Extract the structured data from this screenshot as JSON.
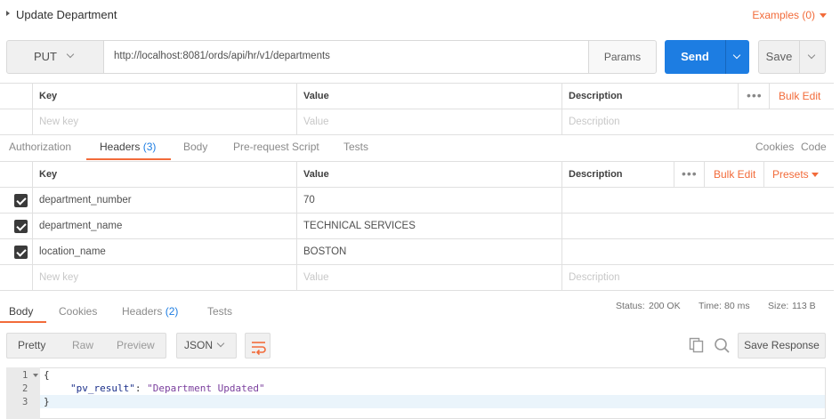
{
  "request": {
    "title": "Update Department",
    "examples_label": "Examples (0)",
    "method": "PUT",
    "url": "http://localhost:8081/ords/api/hr/v1/departments",
    "params_label": "Params",
    "send_label": "Send",
    "save_label": "Save"
  },
  "params_table": {
    "headers": {
      "key": "Key",
      "value": "Value",
      "description": "Description",
      "bulk_edit": "Bulk Edit"
    },
    "placeholders": {
      "key": "New key",
      "value": "Value",
      "description": "Description"
    }
  },
  "request_tabs": {
    "items": [
      {
        "label": "Authorization"
      },
      {
        "label": "Headers",
        "count": "(3)"
      },
      {
        "label": "Body"
      },
      {
        "label": "Pre-request Script"
      },
      {
        "label": "Tests"
      }
    ],
    "active": "Headers",
    "cookies_label": "Cookies",
    "code_label": "Code"
  },
  "headers_table": {
    "headers": {
      "key": "Key",
      "value": "Value",
      "description": "Description",
      "bulk_edit": "Bulk Edit",
      "presets": "Presets"
    },
    "rows": [
      {
        "key": "department_number",
        "value": "70",
        "description": "",
        "checked": true
      },
      {
        "key": "department_name",
        "value": "TECHNICAL SERVICES",
        "description": "",
        "checked": true
      },
      {
        "key": "location_name",
        "value": "BOSTON",
        "description": "",
        "checked": true
      }
    ],
    "placeholders": {
      "key": "New key",
      "value": "Value",
      "description": "Description"
    }
  },
  "response": {
    "tabs": [
      {
        "label": "Body"
      },
      {
        "label": "Cookies"
      },
      {
        "label": "Headers",
        "count": "(2)"
      },
      {
        "label": "Tests"
      }
    ],
    "active_tab": "Body",
    "status_label": "Status:",
    "status_value": "200 OK",
    "time_label": "Time:",
    "time_value": "80 ms",
    "size_label": "Size:",
    "size_value": "113 B",
    "views": [
      "Pretty",
      "Raw",
      "Preview"
    ],
    "active_view": "Pretty",
    "format": "JSON",
    "save_response_label": "Save Response",
    "body_lines": [
      {
        "num": "1",
        "text": "{"
      },
      {
        "num": "2",
        "key": "\"pv_result\"",
        "sep": ": ",
        "value": "\"Department Updated\""
      },
      {
        "num": "3",
        "text": "}"
      }
    ]
  },
  "colors": {
    "accent": "#f26b3a",
    "primary": "#1d7de2",
    "json_key": "#1b2f8a",
    "json_string": "#7a3e9d"
  },
  "icons": [
    "caret-right-icon",
    "caret-down-icon",
    "chevron-down-icon",
    "more-dots-icon",
    "checkbox-checked-icon",
    "wrap-lines-icon",
    "copy-icon",
    "search-icon"
  ]
}
